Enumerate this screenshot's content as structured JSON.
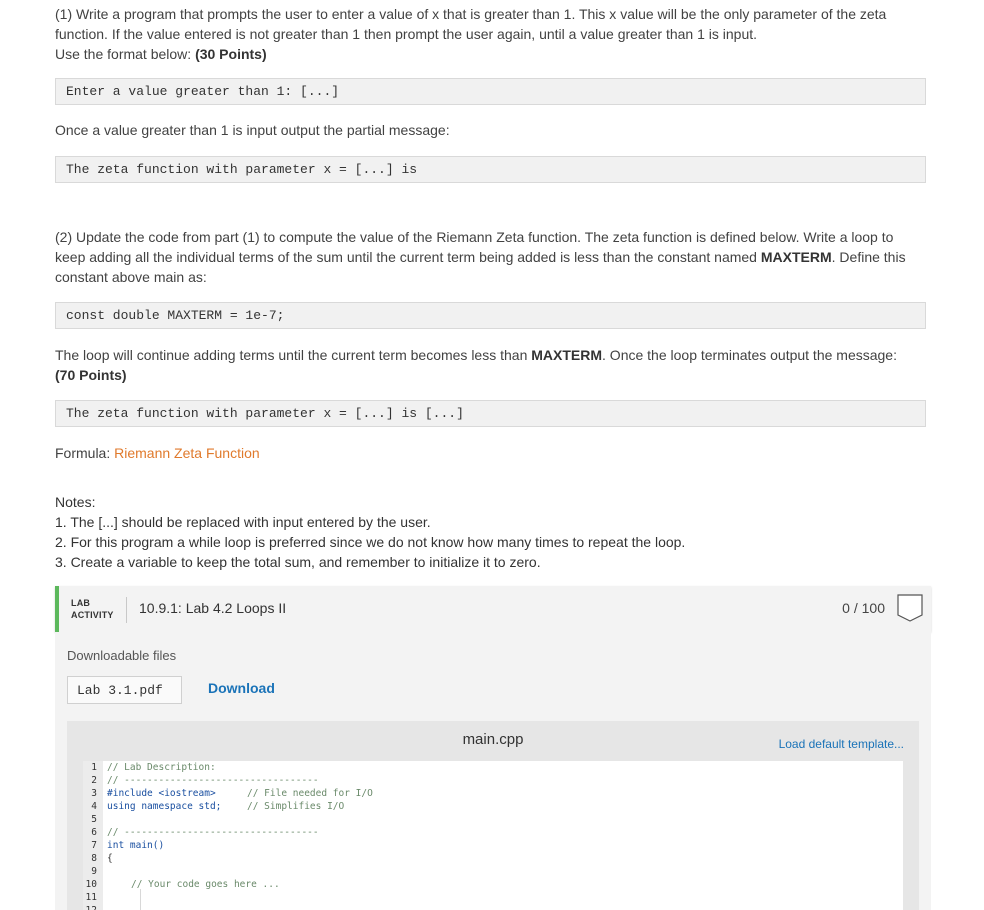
{
  "part1": {
    "line1": "(1) Write a program that prompts the user to enter a value of x that is greater than 1. This x value will be the only parameter of the zeta",
    "line2": "function. If the value entered is not greater than 1 then prompt the user again, until a value greater than 1 is input.",
    "line3_prefix": "Use the format below: ",
    "line3_points": "(30 Points)",
    "code1": "Enter a value greater than 1: [...]",
    "after": "Once a value greater than 1 is input output the partial message:",
    "code2": "The zeta function with parameter x = [...] is"
  },
  "part2": {
    "line1": "(2) Update the code from part (1) to compute the value of the Riemann Zeta function. The zeta function is defined below. Write a loop to",
    "line2_prefix": "keep adding all the individual terms of the sum until the current term being added is less than the constant named ",
    "line2_const": "MAXTERM",
    "line2_suffix": ". Define this",
    "line3": "constant above main as:",
    "code1": "const double MAXTERM = 1e-7;",
    "loop_prefix": "The loop will continue adding terms until the current term becomes less than ",
    "loop_const": "MAXTERM",
    "loop_suffix": ". Once the loop terminates output the message:",
    "points": "(70 Points)",
    "code2": "The zeta function with parameter x = [...] is [...]",
    "formula_label": "Formula: ",
    "formula_link": "Riemann Zeta Function"
  },
  "notes": {
    "title": "Notes:",
    "items": [
      "1. The [...] should be replaced with input entered by the user.",
      "2. For this program a while loop is preferred since we do not know how many times to repeat the loop.",
      "3. Create a variable to keep the total sum, and remember to initialize it to zero."
    ]
  },
  "lab": {
    "tag_line1": "LAB",
    "tag_line2": "ACTIVITY",
    "title": "10.9.1: Lab 4.2 Loops II",
    "score": "0 / 100",
    "downloadable_label": "Downloadable files",
    "file_name": "Lab 3.1.pdf",
    "download_label": "Download",
    "editor_file": "main.cpp",
    "load_template": "Load default template...",
    "accent_color": "#5cb85c",
    "link_color": "#1a73b8"
  },
  "code": {
    "l1": "// Lab Description:",
    "l2": "// ----------------------------------",
    "l3_inc": "#include <iostream>",
    "l3_cmt": "// File needed for I/O",
    "l4_kw": "using namespace std;",
    "l4_cmt": "// Simplifies I/O",
    "l6": "// ----------------------------------",
    "l7": "int main()",
    "l8": "{",
    "l10": "// Your code goes here ..."
  }
}
